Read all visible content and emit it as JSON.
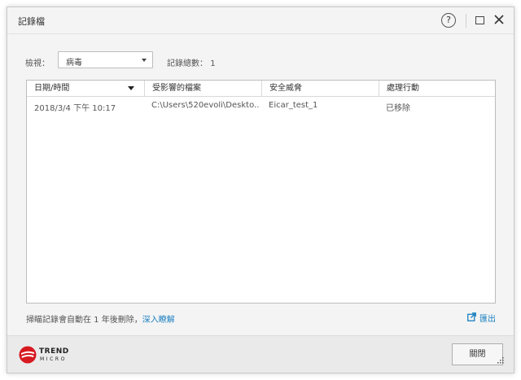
{
  "window": {
    "title": "記錄檔",
    "help_label": "?"
  },
  "filter": {
    "view_label": "檢視：",
    "view_value": "病毒",
    "count_label": "記錄總數：",
    "count_value": "1"
  },
  "table": {
    "columns": [
      "日期/時間",
      "受影響的檔案",
      "安全威脅",
      "處理行動"
    ],
    "rows": [
      [
        "2018/3/4 下午 10:17",
        "C:\\Users\\520evoli\\Deskto...",
        "Eicar_test_1",
        "已移除"
      ]
    ]
  },
  "footer": {
    "note": "掃瞄記錄會自動在 1 年後刪除，",
    "learn_more": "深入瞭解",
    "export_label": "匯出"
  },
  "bottom": {
    "brand_line1": "TREND",
    "brand_line2": "MICRO",
    "close_button": "關閉"
  },
  "colors": {
    "link": "#1a7fc0",
    "brand_red": "#d71920",
    "window_bg": "#f4f4f4"
  }
}
